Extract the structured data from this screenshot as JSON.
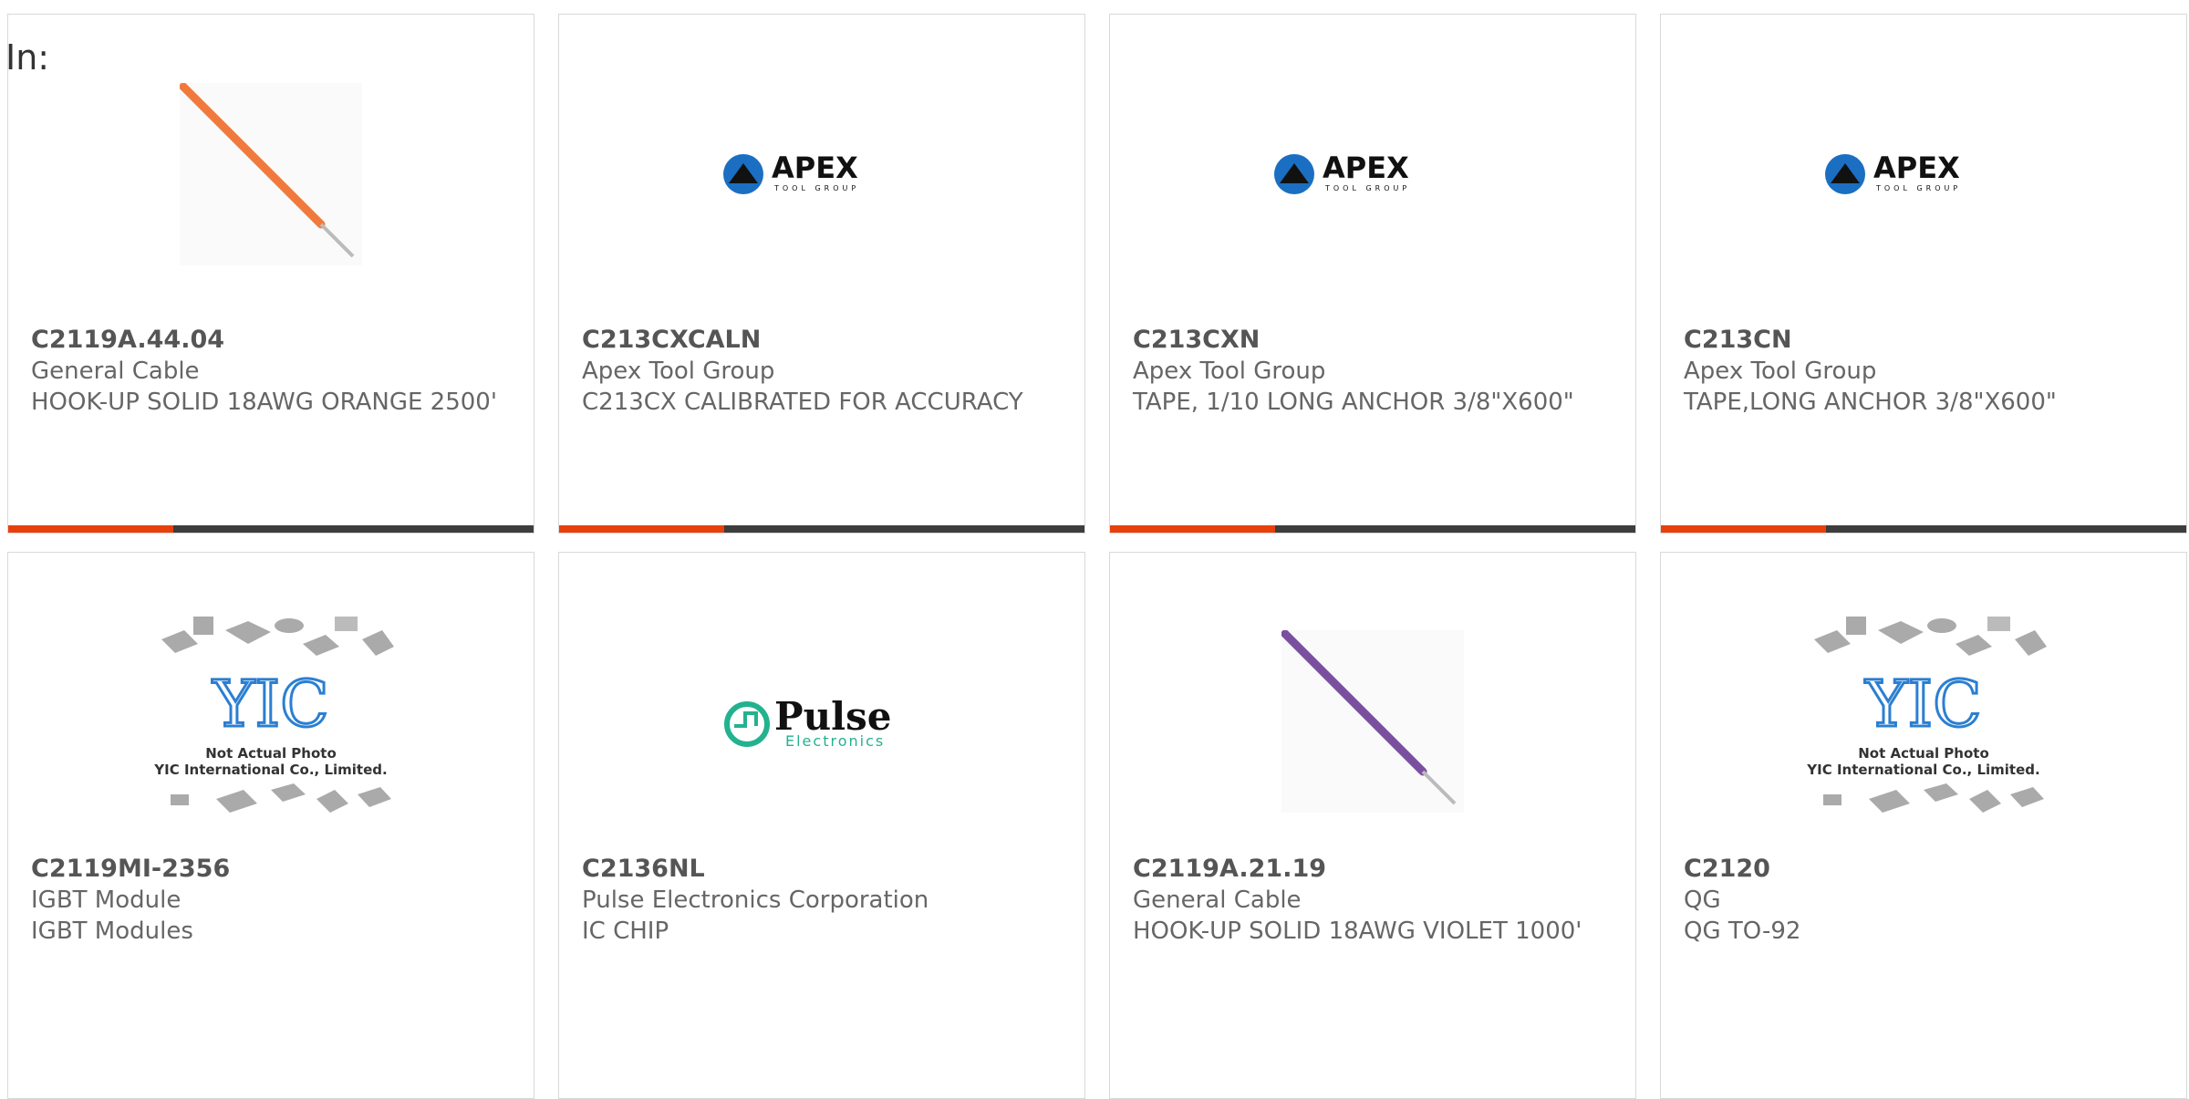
{
  "filter": {
    "label": "In:"
  },
  "colors": {
    "accent": "#e8400c",
    "bar": "#3d3d3d",
    "border": "#d9d9d9",
    "text": "#666666"
  },
  "products": [
    {
      "part": "C2119A.44.04",
      "maker": "General Cable",
      "desc": "HOOK-UP SOLID 18AWG ORANGE 2500'",
      "image": "orange-wire-photo"
    },
    {
      "part": "C213CXCALN",
      "maker": "Apex Tool Group",
      "desc": "C213CX CALIBRATED FOR ACCURACY",
      "image": "apex-logo"
    },
    {
      "part": "C213CXN",
      "maker": "Apex Tool Group",
      "desc": "TAPE, 1/10 LONG ANCHOR 3/8\"X600\"",
      "image": "apex-logo"
    },
    {
      "part": "C213CN",
      "maker": "Apex Tool Group",
      "desc": "TAPE,LONG ANCHOR 3/8\"X600\"",
      "image": "apex-logo"
    },
    {
      "part": "C2119MI-2356",
      "maker": "IGBT Module",
      "desc": "IGBT Modules",
      "image": "yic-placeholder"
    },
    {
      "part": "C2136NL",
      "maker": "Pulse Electronics Corporation",
      "desc": "IC CHIP",
      "image": "pulse-logo"
    },
    {
      "part": "C2119A.21.19",
      "maker": "General Cable",
      "desc": "HOOK-UP SOLID 18AWG VIOLET 1000'",
      "image": "violet-wire-photo"
    },
    {
      "part": "C2120",
      "maker": "QG",
      "desc": "QG TO-92",
      "image": "yic-placeholder"
    }
  ],
  "logos": {
    "apex": {
      "main": "APEX",
      "sub": "TOOL GROUP"
    },
    "pulse": {
      "main": "Pulse",
      "sub": "Electronics"
    },
    "yic": {
      "mark": "YIC",
      "line1": "Not Actual Photo",
      "line2": "YIC International Co., Limited."
    }
  }
}
